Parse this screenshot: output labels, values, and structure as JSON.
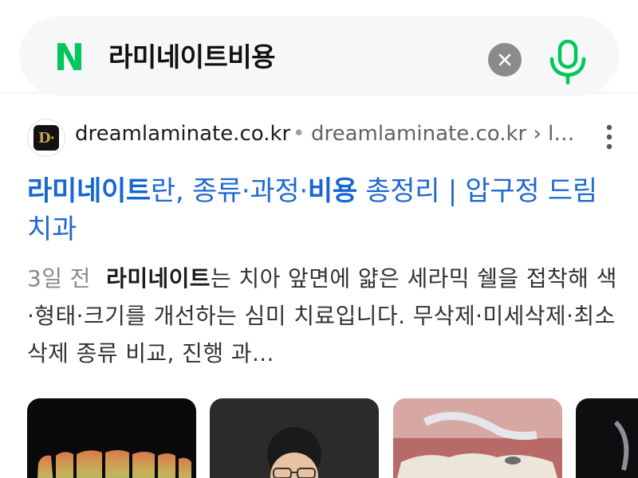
{
  "search": {
    "logo": "N",
    "query": "라미네이트비용"
  },
  "result": {
    "site_name": "dreamlaminate.co.kr",
    "separator": "•",
    "url_path": "dreamlaminate.co.kr › la...",
    "favicon_letter": "D·",
    "title_parts": [
      {
        "text": "라미네이트",
        "bold": true
      },
      {
        "text": "란, 종류·과정·",
        "bold": false
      },
      {
        "text": "비용",
        "bold": true
      },
      {
        "text": " 총정리 | 압구정 드림치과",
        "bold": false
      }
    ],
    "date": "3일 전",
    "snippet_bold": "라미네이트",
    "snippet_rest": "는 치아 앞면에 얇은 세라믹 쉘을 접착해 색·형태·크기를 개선하는 심미 치료입니다. 무삭제·미세삭제·최소삭제 종류 비교, 진행 과...",
    "thumbnails": [
      "teeth-veneers-dark",
      "dentist-portrait",
      "teeth-closeup",
      "dark-image"
    ]
  },
  "colors": {
    "brand_green": "#03c75a",
    "link_blue": "#1a5fb4",
    "search_bg": "#f6f7f9"
  },
  "icons": {
    "clear": "close-icon",
    "mic": "microphone-icon",
    "more": "more-vertical-icon"
  }
}
